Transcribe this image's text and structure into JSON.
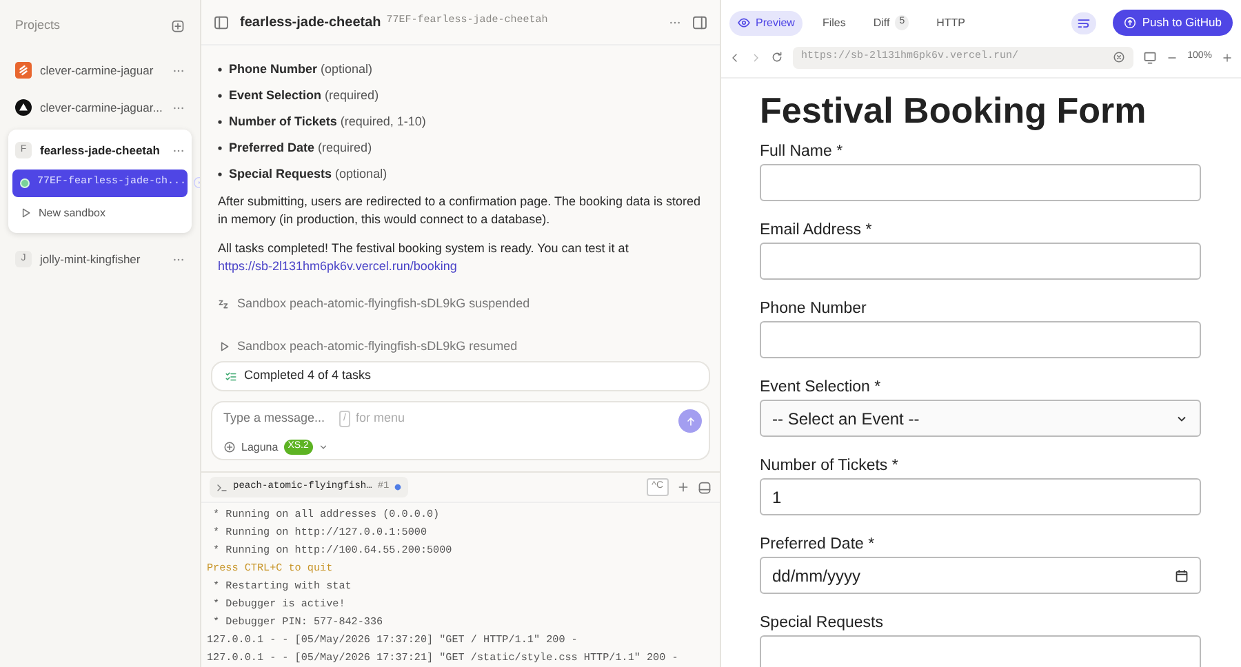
{
  "sidebar": {
    "title": "Projects",
    "projects": [
      {
        "name": "clever-carmine-jaguar",
        "kind": "logo-orange",
        "expanded": false
      },
      {
        "name": "clever-carmine-jaguar...",
        "kind": "logo-dark",
        "expanded": false
      },
      {
        "name": "fearless-jade-cheetah",
        "kind": "letter",
        "letter": "F",
        "expanded": true,
        "sandboxes": [
          {
            "name": "77EF-fearless-jade-ch...",
            "selected": true
          }
        ],
        "new_sandbox": "New sandbox"
      },
      {
        "name": "jolly-mint-kingfisher",
        "kind": "letter",
        "letter": "J",
        "expanded": false
      }
    ]
  },
  "chat": {
    "title": "fearless-jade-cheetah",
    "subtitle": "77EF-fearless-jade-cheetah",
    "fields": [
      {
        "name": "Phone Number",
        "note": "(optional)"
      },
      {
        "name": "Event Selection",
        "note": "(required)"
      },
      {
        "name": "Number of Tickets",
        "note": "(required, 1-10)"
      },
      {
        "name": "Preferred Date",
        "note": "(required)"
      },
      {
        "name": "Special Requests",
        "note": "(optional)"
      }
    ],
    "paragraph": "After submitting, users are redirected to a confirmation page. The booking data is stored in memory (in production, this would connect to a database).",
    "done_text": "All tasks completed! The festival booking system is ready. You can test it at",
    "link": "https://sb-2l131hm6pk6v.vercel.run/booking",
    "events": [
      {
        "kind": "suspended",
        "text": "Sandbox peach-atomic-flyingfish-sDL9kG suspended"
      },
      {
        "kind": "resumed",
        "text": "Sandbox peach-atomic-flyingfish-sDL9kG resumed"
      }
    ],
    "tasks": "Completed 4 of 4 tasks",
    "composer": {
      "placeholder": "Type a message...",
      "key": "/",
      "key_hint": "for menu",
      "model": "Laguna",
      "model_badge": "XS.2"
    }
  },
  "terminal": {
    "tab": "peach-atomic-flyingfish…",
    "tab_number": "#1",
    "interrupt": "^C",
    "lines": [
      {
        "kind": "normal",
        "text": " * Running on all addresses (0.0.0.0)"
      },
      {
        "kind": "normal",
        "text": " * Running on http://127.0.0.1:5000"
      },
      {
        "kind": "normal",
        "text": " * Running on http://100.64.55.200:5000"
      },
      {
        "kind": "warning",
        "text": "Press CTRL+C to quit"
      },
      {
        "kind": "normal",
        "text": " * Restarting with stat"
      },
      {
        "kind": "normal",
        "text": " * Debugger is active!"
      },
      {
        "kind": "normal",
        "text": " * Debugger PIN: 577-842-336"
      },
      {
        "kind": "normal",
        "text": "127.0.0.1 - - [05/May/2026 17:37:20] \"GET / HTTP/1.1\" 200 -"
      },
      {
        "kind": "normal",
        "text": "127.0.0.1 - - [05/May/2026 17:37:21] \"GET /static/style.css HTTP/1.1\" 200 -"
      }
    ]
  },
  "preview": {
    "tabs": [
      {
        "label": "Preview",
        "selected": true
      },
      {
        "label": "Files",
        "selected": false
      },
      {
        "label": "Diff",
        "badge": "5",
        "selected": false
      },
      {
        "label": "HTTP",
        "selected": false
      }
    ],
    "push_button": "Push to GitHub",
    "url": "https://sb-2l131hm6pk6v.vercel.run/",
    "zoom": "100%",
    "form": {
      "title": "Festival Booking Form",
      "fields": [
        {
          "label": "Full Name *",
          "kind": "text"
        },
        {
          "label": "Email Address *",
          "kind": "text"
        },
        {
          "label": "Phone Number",
          "kind": "text"
        },
        {
          "label": "Event Selection *",
          "kind": "select",
          "value": "-- Select an Event --"
        },
        {
          "label": "Number of Tickets *",
          "kind": "text",
          "value": "1"
        },
        {
          "label": "Preferred Date *",
          "kind": "date",
          "value": "dd/mm/yyyy"
        },
        {
          "label": "Special Requests",
          "kind": "textarea"
        }
      ]
    }
  }
}
